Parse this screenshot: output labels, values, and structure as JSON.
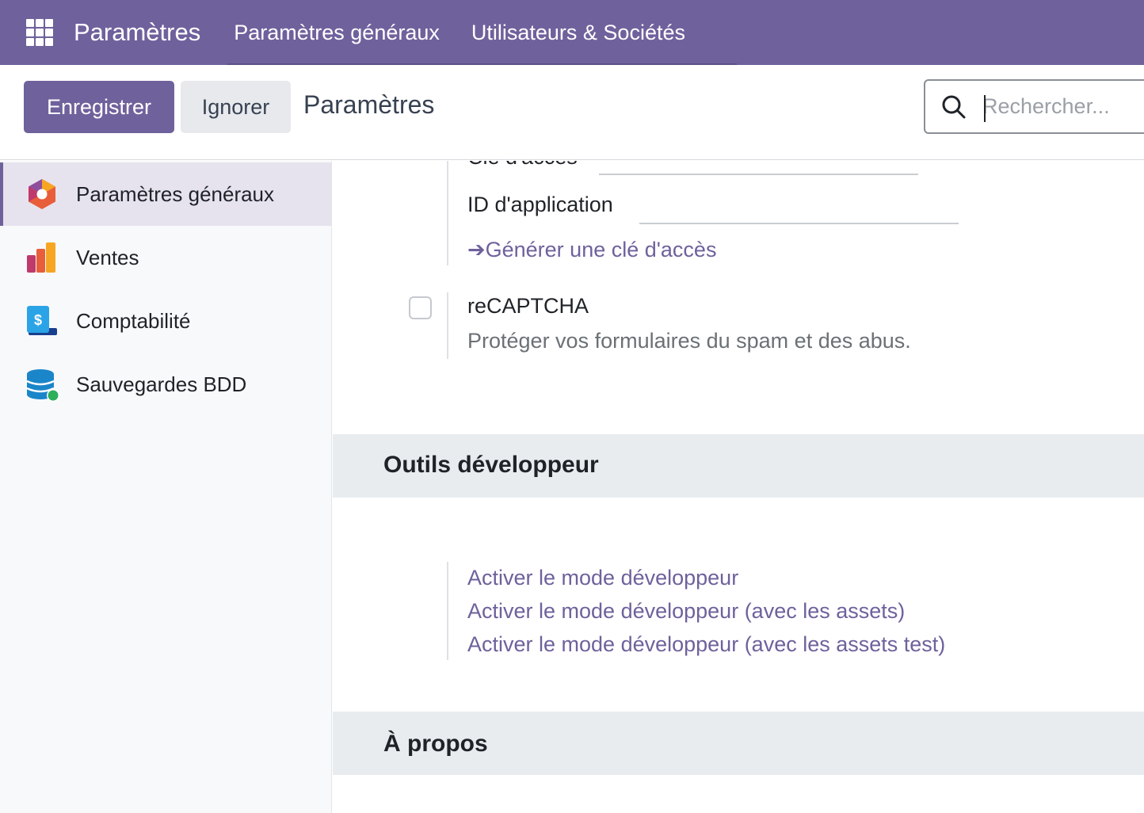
{
  "navbar": {
    "apps_icon": "grid-icon",
    "brand": "Paramètres",
    "menu": [
      "Paramètres généraux",
      "Utilisateurs & Sociétés"
    ]
  },
  "control_panel": {
    "save_label": "Enregistrer",
    "discard_label": "Ignorer",
    "title": "Paramètres",
    "search_placeholder": "Rechercher..."
  },
  "sidebar": {
    "items": [
      {
        "label": "Paramètres généraux",
        "icon": "settings-app-icon",
        "active": true
      },
      {
        "label": "Ventes",
        "icon": "sales-app-icon",
        "active": false
      },
      {
        "label": "Comptabilité",
        "icon": "accounting-app-icon",
        "active": false
      },
      {
        "label": "Sauvegardes BDD",
        "icon": "database-backup-icon",
        "active": false
      }
    ]
  },
  "main": {
    "partial_field_label": "Clé d'accès",
    "app_id_label": "ID d'application",
    "generate_key_link": "➔Générer une clé d'accès",
    "recaptcha": {
      "title": "reCAPTCHA",
      "description": "Protéger vos formulaires du spam et des abus.",
      "checked": false
    },
    "dev_tools": {
      "title": "Outils développeur",
      "links": [
        "Activer le mode développeur",
        "Activer le mode développeur (avec les assets)",
        "Activer le mode développeur (avec les assets test)"
      ]
    },
    "about": {
      "title": "À propos"
    }
  },
  "colors": {
    "brand": "#6f619c",
    "section_bg": "#e9ecef",
    "sidebar_bg": "#f8f9fa",
    "active_bg": "#e6e3ee"
  }
}
